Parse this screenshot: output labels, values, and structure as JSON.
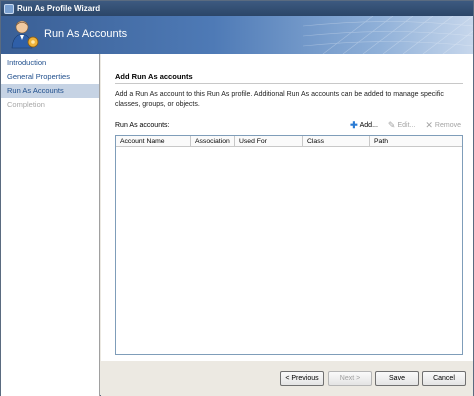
{
  "window": {
    "title": "Run As Profile Wizard"
  },
  "banner": {
    "heading": "Run As Accounts",
    "icon": "user-gear-icon"
  },
  "nav": {
    "items": [
      {
        "label": "Introduction",
        "state": "normal"
      },
      {
        "label": "General Properties",
        "state": "normal"
      },
      {
        "label": "Run As Accounts",
        "state": "selected"
      },
      {
        "label": "Completion",
        "state": "disabled"
      }
    ]
  },
  "content": {
    "section_title": "Add Run As accounts",
    "description": "Add a Run As account to this Run As profile.  Additional Run As accounts can be added to manage specific classes, groups, or objects.",
    "accounts_label": "Run As accounts:",
    "toolbar": {
      "add": "Add...",
      "edit": "Edit...",
      "remove": "Remove"
    },
    "table": {
      "columns": [
        "Account Name",
        "Association",
        "Used For",
        "Class",
        "Path"
      ],
      "rows": []
    }
  },
  "footer": {
    "previous": "< Previous",
    "next": "Next >",
    "save": "Save",
    "cancel": "Cancel"
  },
  "colors": {
    "accent": "#1f4e8c",
    "selected_bg": "#c6d3e4",
    "banner": "#3a5f95"
  }
}
